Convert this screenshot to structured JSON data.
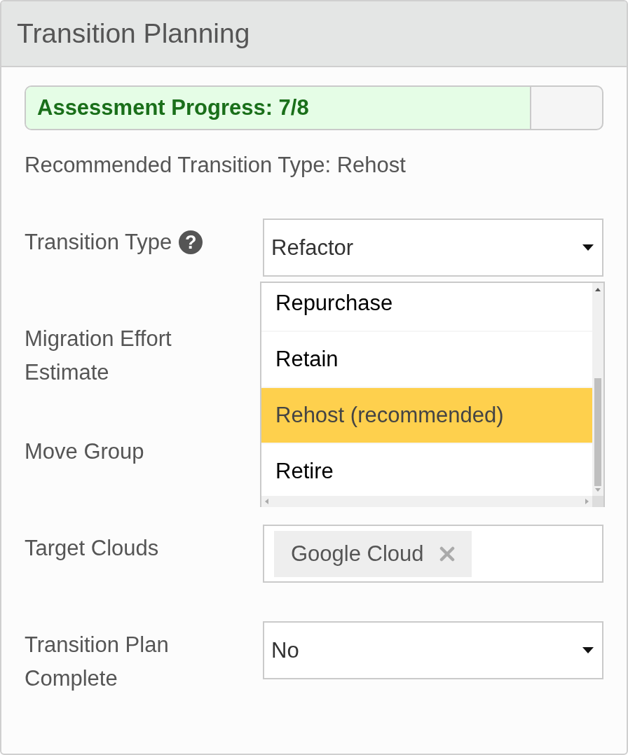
{
  "panel": {
    "title": "Transition Planning"
  },
  "progress": {
    "label": "Assessment Progress: 7/8",
    "level": 0.875
  },
  "recommendation": "Recommended Transition Type: Rehost",
  "fields": [
    {
      "kind": "select",
      "label": "Transition Type",
      "help": "?",
      "value": "Refactor",
      "options": [
        {
          "label": "Repurchase",
          "selected": false
        },
        {
          "label": "Retain",
          "selected": false
        },
        {
          "label": "Rehost (recommended)",
          "selected": true
        },
        {
          "label": "Retire",
          "selected": false
        }
      ]
    },
    {
      "kind": "covered",
      "label": "Migration Effort Estimate"
    },
    {
      "kind": "covered",
      "label": "Move Group"
    },
    {
      "kind": "tags",
      "label": "Target Clouds",
      "tags": [
        "Google Cloud"
      ]
    },
    {
      "kind": "select",
      "label": "Transition Plan Complete",
      "value": "No"
    }
  ]
}
